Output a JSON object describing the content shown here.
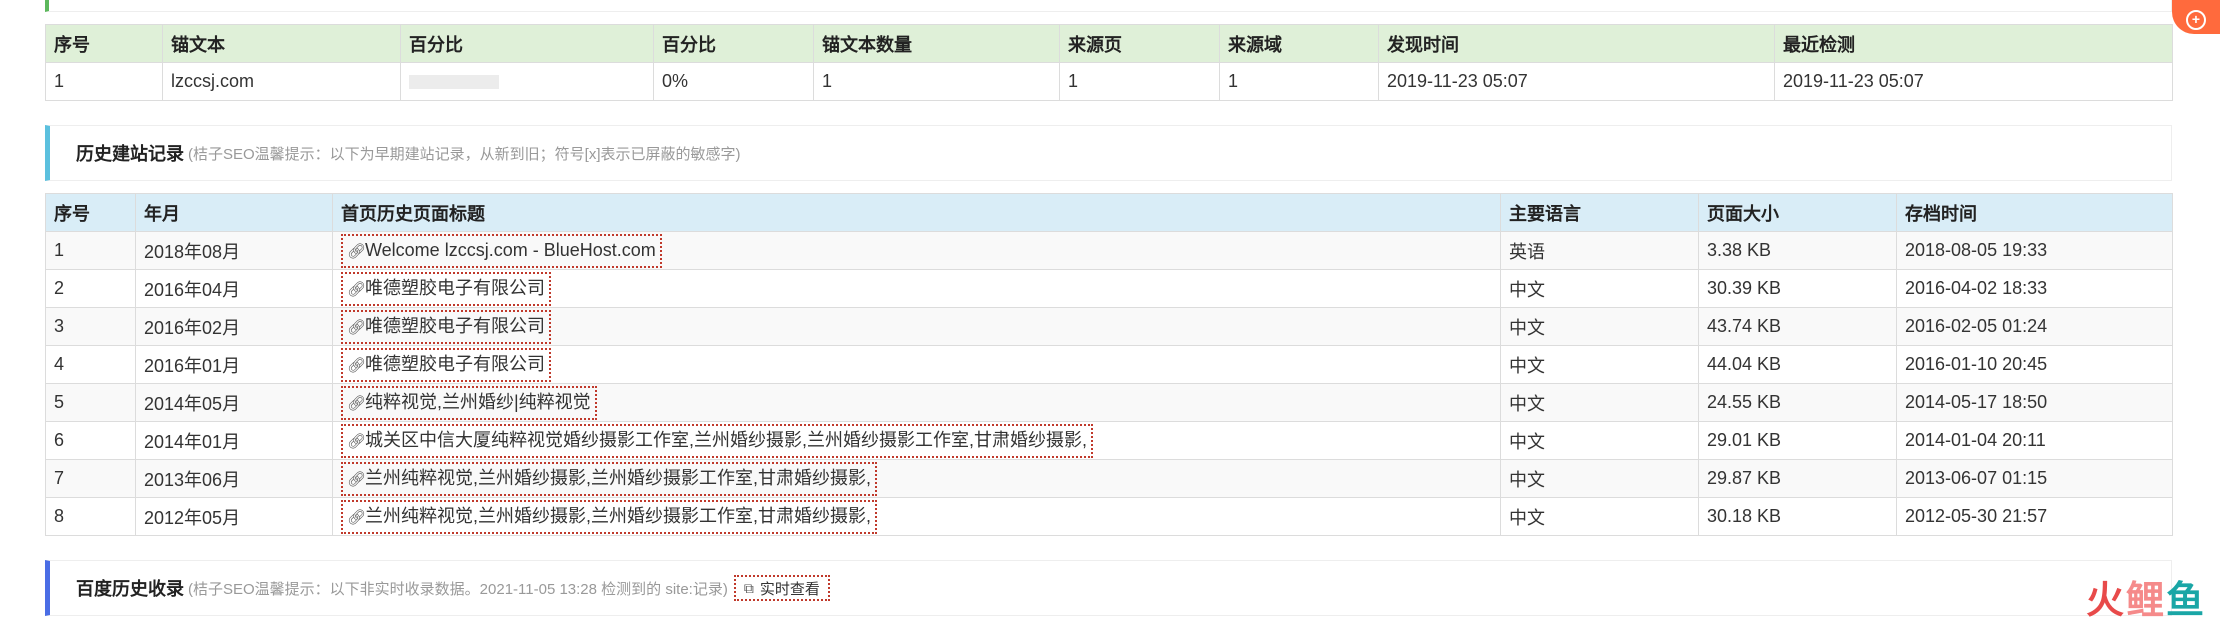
{
  "anchor_table": {
    "headers": [
      "序号",
      "锚文本",
      "百分比",
      "百分比",
      "锚文本数量",
      "来源页",
      "来源域",
      "发现时间",
      "最近检测"
    ],
    "rows": [
      [
        "1",
        "lzccsj.com",
        "",
        "0%",
        "1",
        "1",
        "1",
        "2019-11-23 05:07",
        "2019-11-23 05:07"
      ]
    ]
  },
  "history_section": {
    "title": "历史建站记录",
    "hint": "(桔子SEO温馨提示：以下为早期建站记录，从新到旧；符号[x]表示已屏蔽的敏感字)"
  },
  "history_table": {
    "headers": [
      "序号",
      "年月",
      "首页历史页面标题",
      "主要语言",
      "页面大小",
      "存档时间"
    ],
    "rows": [
      [
        "1",
        "2018年08月",
        "Welcome lzccsj.com - BlueHost.com",
        "英语",
        "3.38 KB",
        "2018-08-05 19:33"
      ],
      [
        "2",
        "2016年04月",
        "唯德塑胶电子有限公司",
        "中文",
        "30.39 KB",
        "2016-04-02 18:33"
      ],
      [
        "3",
        "2016年02月",
        "唯德塑胶电子有限公司",
        "中文",
        "43.74 KB",
        "2016-02-05 01:24"
      ],
      [
        "4",
        "2016年01月",
        "唯德塑胶电子有限公司",
        "中文",
        "44.04 KB",
        "2016-01-10 20:45"
      ],
      [
        "5",
        "2014年05月",
        "纯粹视觉,兰州婚纱|纯粹视觉",
        "中文",
        "24.55 KB",
        "2014-05-17 18:50"
      ],
      [
        "6",
        "2014年01月",
        "城关区中信大厦纯粹视觉婚纱摄影工作室,兰州婚纱摄影,兰州婚纱摄影工作室,甘肃婚纱摄影,",
        "中文",
        "29.01 KB",
        "2014-01-04 20:11"
      ],
      [
        "7",
        "2013年06月",
        "兰州纯粹视觉,兰州婚纱摄影,兰州婚纱摄影工作室,甘肃婚纱摄影,",
        "中文",
        "29.87 KB",
        "2013-06-07 01:15"
      ],
      [
        "8",
        "2012年05月",
        "兰州纯粹视觉,兰州婚纱摄影,兰州婚纱摄影工作室,甘肃婚纱摄影,",
        "中文",
        "30.18 KB",
        "2012-05-30 21:57"
      ]
    ]
  },
  "baidu_section": {
    "title": "百度历史收录",
    "hint": "(桔子SEO温馨提示：以下非实时收录数据。2021-11-05 13:28 检测到的 site:记录)",
    "button_label": "实时查看"
  },
  "side_tab": {
    "label": "+"
  },
  "watermark": {
    "part1": "火",
    "part2": "鲤",
    "part3": "鱼"
  },
  "colors": {
    "green_header": "#dff0d8",
    "blue_header": "#d9edf7",
    "accent_cyan": "#5bc0de",
    "accent_indigo": "#4a6de5",
    "highlight_border": "#c0392b"
  }
}
